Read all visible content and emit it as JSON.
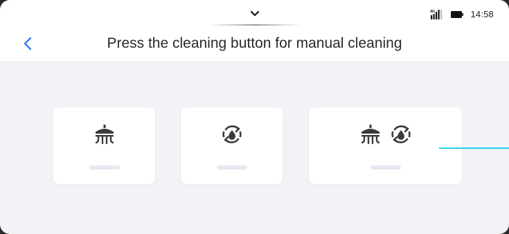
{
  "status_bar": {
    "network_label": "4G",
    "time": "14:58",
    "icons": [
      "chevron-down-icon",
      "signal-icon",
      "battery-icon"
    ]
  },
  "header": {
    "back_icon": "chevron-left-icon",
    "title": "Press the cleaning button for manual cleaning"
  },
  "cleaning_modes": [
    {
      "id": "spray",
      "icons": [
        "shower-spray-icon"
      ]
    },
    {
      "id": "recycle",
      "icons": [
        "water-cycle-icon"
      ]
    },
    {
      "id": "spray-and-recycle",
      "icons": [
        "shower-spray-icon",
        "water-cycle-icon"
      ]
    }
  ],
  "colors": {
    "accent": "#3a7bf0",
    "background": "#f2f3f7",
    "card": "#ffffff",
    "icon": "#3a3a3a",
    "bar": "#e4e8f0",
    "pointer_line": "#1fd2e4"
  }
}
